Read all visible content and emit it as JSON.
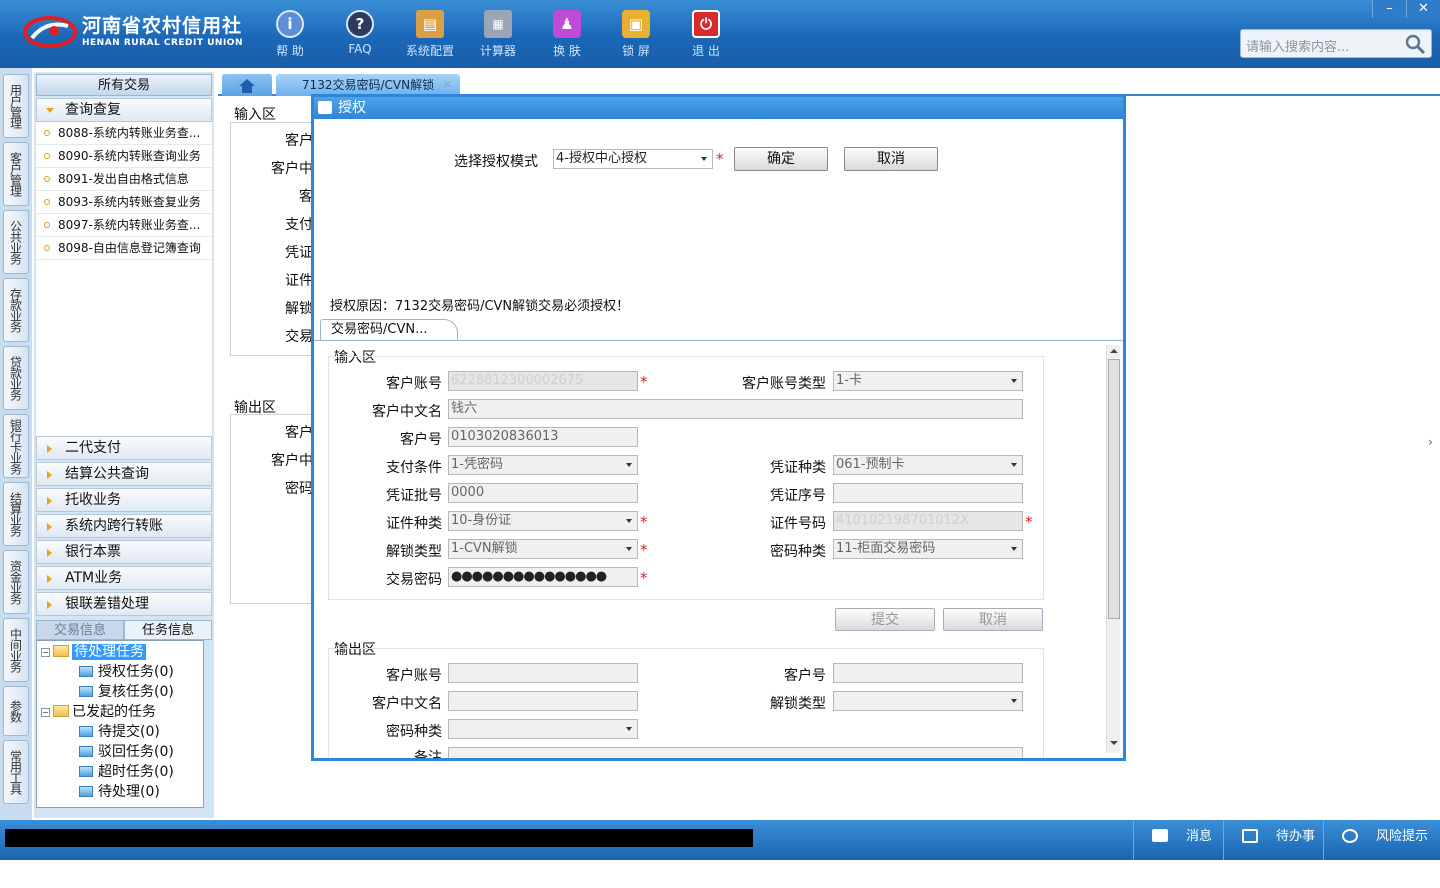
{
  "header": {
    "logo_cn": "河南省农村信用社",
    "logo_en": "HENAN RURAL CREDIT UNION",
    "toolbar": [
      {
        "label": "帮 助",
        "icon": "help-icon",
        "color": "#5b8fd8"
      },
      {
        "label": "FAQ",
        "icon": "faq-icon",
        "color": "#2c3b5c"
      },
      {
        "label": "系统配置",
        "icon": "system-config-icon",
        "color": "#d9a046"
      },
      {
        "label": "计算器",
        "icon": "calculator-icon",
        "color": "#9aa6b6"
      },
      {
        "label": "换 肤",
        "icon": "skin-icon",
        "color": "#c04bd6"
      },
      {
        "label": "锁 屏",
        "icon": "lock-icon",
        "color": "#e8b030"
      },
      {
        "label": "退 出",
        "icon": "exit-icon",
        "color": "#d82a2a"
      }
    ],
    "search_placeholder": "请输入搜索内容...",
    "window_buttons": [
      "–",
      "✕"
    ]
  },
  "vertical_tabs": [
    "用户管理",
    "客户管理",
    "公共业务",
    "存款业务",
    "贷款业务",
    "银行卡业务",
    "结算业务",
    "资金业务",
    "中间业务",
    "参数",
    "常用工具"
  ],
  "left_panel": {
    "title": "所有交易",
    "open_category": "查询查复",
    "sub_items": [
      "8088-系统内转账业务查...",
      "8090-系统内转账查询业务",
      "8091-发出自由格式信息",
      "8093-系统内转账查复业务",
      "8097-系统内转账业务查...",
      "8098-自由信息登记簿查询"
    ],
    "categories": [
      "二代支付",
      "结算公共查询",
      "托收业务",
      "系统内跨行转账",
      "银行本票",
      "ATM业务",
      "银联差错处理"
    ],
    "task_tabs": [
      "交易信息",
      "任务信息"
    ],
    "tree": {
      "pending": "待处理任务",
      "pending_children": [
        "授权任务(0)",
        "复核任务(0)"
      ],
      "initiated": "已发起的任务",
      "initiated_children": [
        "待提交(0)",
        "驳回任务(0)",
        "超时任务(0)",
        "待处理(0)"
      ]
    }
  },
  "tabs": {
    "active_tab": "7132交易密码/CVN解锁",
    "close": "✕"
  },
  "background_form": {
    "input_area": "输入区",
    "input_labels": [
      "客户",
      "客户中",
      "客",
      "支付",
      "凭证",
      "证件",
      "解锁",
      "交易"
    ],
    "output_area": "输出区",
    "output_labels": [
      "客户",
      "客户中",
      "密码"
    ]
  },
  "dialog": {
    "title": "授权",
    "mode_label": "选择授权模式",
    "mode_value": "4-授权中心授权",
    "confirm": "确定",
    "cancel": "取消",
    "reason": "授权原因：7132交易密码/CVN解锁交易必须授权！",
    "inner_tab": "交易密码/CVN...",
    "input_area": "输入区",
    "fields": {
      "account_label": "客户账号",
      "account_value": "6228812300002675",
      "account_type_label": "客户账号类型",
      "account_type_value": "1-卡",
      "cn_name_label": "客户中文名",
      "cn_name_value": "钱六",
      "customer_no_label": "客户号",
      "customer_no_value": "0103020836013",
      "pay_cond_label": "支付条件",
      "pay_cond_value": "1-凭密码",
      "voucher_type_label": "凭证种类",
      "voucher_type_value": "061-预制卡",
      "voucher_batch_label": "凭证批号",
      "voucher_batch_value": "0000",
      "voucher_seq_label": "凭证序号",
      "voucher_seq_value": "",
      "id_type_label": "证件种类",
      "id_type_value": "10-身份证",
      "id_no_label": "证件号码",
      "id_no_value": "410102198701012X",
      "unlock_type_label": "解锁类型",
      "unlock_type_value": "1-CVN解锁",
      "pwd_type_label": "密码种类",
      "pwd_type_value": "11-柜面交易密码",
      "txn_pwd_label": "交易密码",
      "txn_pwd_value": "●●●●●●●●●●●●●●●"
    },
    "submit": "提交",
    "cancel2": "取消",
    "output_area": "输出区",
    "out_fields": {
      "account_label": "客户账号",
      "customer_no_label": "客户号",
      "cn_name_label": "客户中文名",
      "unlock_type_label": "解锁类型",
      "pwd_type_label": "密码种类",
      "remark_label": "备注"
    }
  },
  "status_bar": {
    "items": [
      {
        "label": "消息",
        "icon": "message-icon"
      },
      {
        "label": "待办事项",
        "icon": "todo-icon"
      },
      {
        "label": "风险提示",
        "icon": "risk-icon"
      }
    ]
  }
}
